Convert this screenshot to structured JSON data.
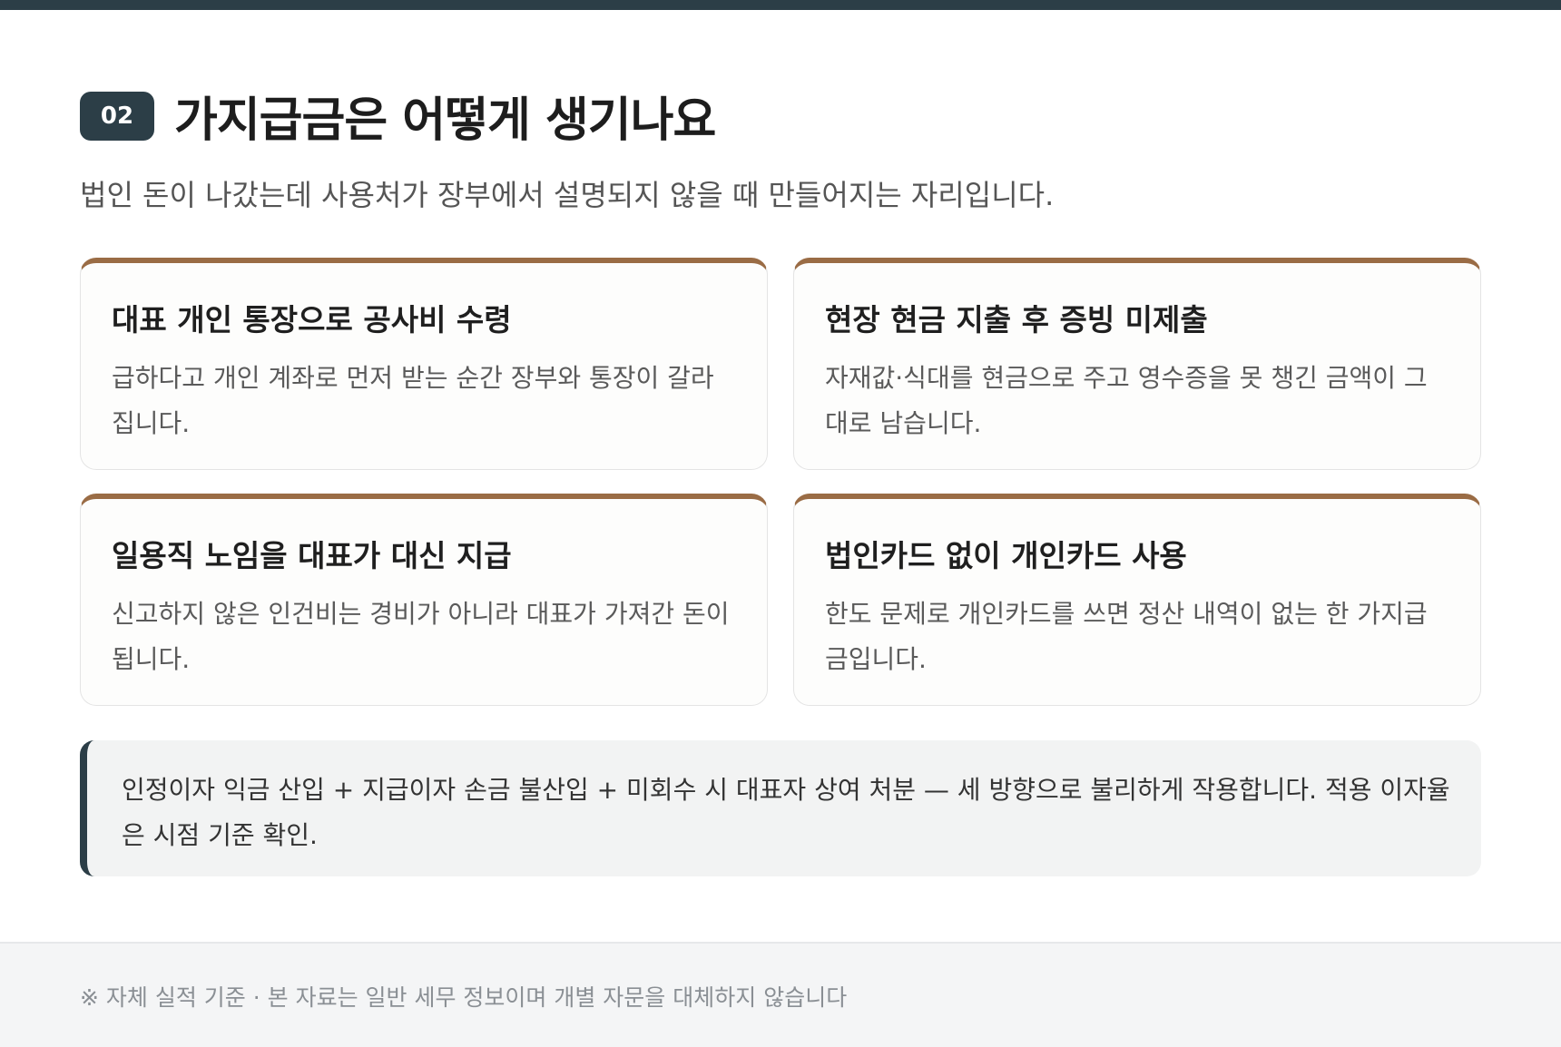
{
  "section": {
    "number": "02",
    "title": "가지급금은 어떻게 생기나요",
    "subtitle": "법인 돈이 나갔는데 사용처가 장부에서 설명되지 않을 때 만들어지는 자리입니다."
  },
  "cards": [
    {
      "title": "대표 개인 통장으로 공사비 수령",
      "description": "급하다고 개인 계좌로 먼저 받는 순간 장부와 통장이 갈라집니다."
    },
    {
      "title": "현장 현금 지출 후 증빙 미제출",
      "description": "자재값·식대를 현금으로 주고 영수증을 못 챙긴 금액이 그대로 남습니다."
    },
    {
      "title": "일용직 노임을 대표가 대신 지급",
      "description": "신고하지 않은 인건비는 경비가 아니라 대표가 가져간 돈이 됩니다."
    },
    {
      "title": "법인카드 없이 개인카드 사용",
      "description": "한도 문제로 개인카드를 쓰면 정산 내역이 없는 한 가지급금입니다."
    }
  ],
  "callout": {
    "text": "인정이자 익금 산입 + 지급이자 손금 불산입 + 미회수 시 대표자 상여 처분 — 세 방향으로 불리하게 작용합니다. 적용 이자율은 시점 기준 확인."
  },
  "footer": {
    "note": "※ 자체 실적 기준 · 본 자료는 일반 세무 정보이며 개별 자문을 대체하지 않습니다"
  },
  "colors": {
    "dark": "#2c3e47",
    "accent": "#9a6c45",
    "callout_bg": "#f2f3f3",
    "footer_bg": "#f4f5f6"
  }
}
